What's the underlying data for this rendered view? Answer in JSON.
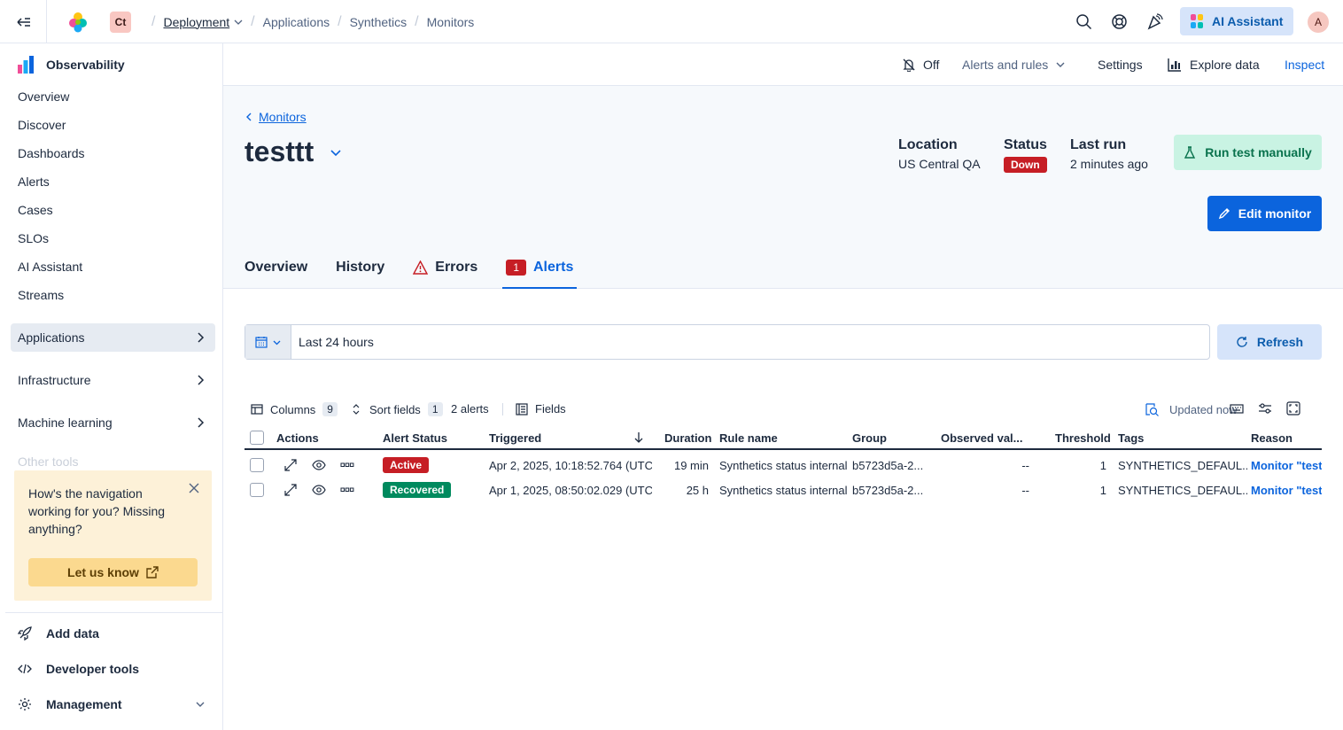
{
  "header": {
    "space_initials": "Ct",
    "breadcrumbs": [
      "Deployment",
      "Applications",
      "Synthetics",
      "Monitors"
    ],
    "ai_assistant_label": "AI Assistant",
    "avatar_initial": "A"
  },
  "sidebar": {
    "solution_title": "Observability",
    "items": [
      "Overview",
      "Discover",
      "Dashboards",
      "Alerts",
      "Cases",
      "SLOs",
      "AI Assistant",
      "Streams"
    ],
    "groups": [
      "Applications",
      "Infrastructure",
      "Machine learning"
    ],
    "faded_item": "Other tools",
    "callout": {
      "message": "How's the navigation working for you? Missing anything?",
      "button": "Let us know"
    },
    "bottom": [
      "Add data",
      "Developer tools",
      "Management"
    ]
  },
  "subbar": {
    "off_label": "Off",
    "alerts_rules": "Alerts and rules",
    "settings": "Settings",
    "explore": "Explore data",
    "inspect": "Inspect"
  },
  "page": {
    "back_label": "Monitors",
    "title": "testtt",
    "location_label": "Location",
    "location_value": "US Central QA",
    "status_label": "Status",
    "status_value": "Down",
    "lastrun_label": "Last run",
    "lastrun_value": "2 minutes ago",
    "run_test": "Run test manually",
    "edit": "Edit monitor",
    "tabs": {
      "overview": "Overview",
      "history": "History",
      "errors": "Errors",
      "alerts": "Alerts",
      "alerts_count": "1"
    }
  },
  "filters": {
    "date_range": "Last 24 hours",
    "refresh": "Refresh"
  },
  "toolbar": {
    "columns": "Columns",
    "columns_count": "9",
    "sort": "Sort fields",
    "sort_count": "1",
    "alerts_count": "2 alerts",
    "fields": "Fields",
    "updated": "Updated now"
  },
  "table": {
    "headers": [
      "Actions",
      "Alert Status",
      "Triggered",
      "Duration",
      "Rule name",
      "Group",
      "Observed val...",
      "Threshold",
      "Tags",
      "Reason"
    ],
    "rows": [
      {
        "status": "Active",
        "triggered": "Apr 2, 2025, 10:18:52.764 (UTC",
        "duration": "19 min",
        "rule": "Synthetics status internal",
        "group": "b5723d5a-2...",
        "observed": "--",
        "threshold": "1",
        "tags": "SYNTHETICS_DEFAUL...",
        "reason": "Monitor \"testt"
      },
      {
        "status": "Recovered",
        "triggered": "Apr 1, 2025, 08:50:02.029 (UTC",
        "duration": "25 h",
        "rule": "Synthetics status internal",
        "group": "b5723d5a-2...",
        "observed": "--",
        "threshold": "1",
        "tags": "SYNTHETICS_DEFAUL...",
        "reason": "Monitor \"testt"
      }
    ]
  },
  "colors": {
    "accent": "#0b64dd",
    "danger": "#c61e25",
    "success": "#008a5e"
  }
}
